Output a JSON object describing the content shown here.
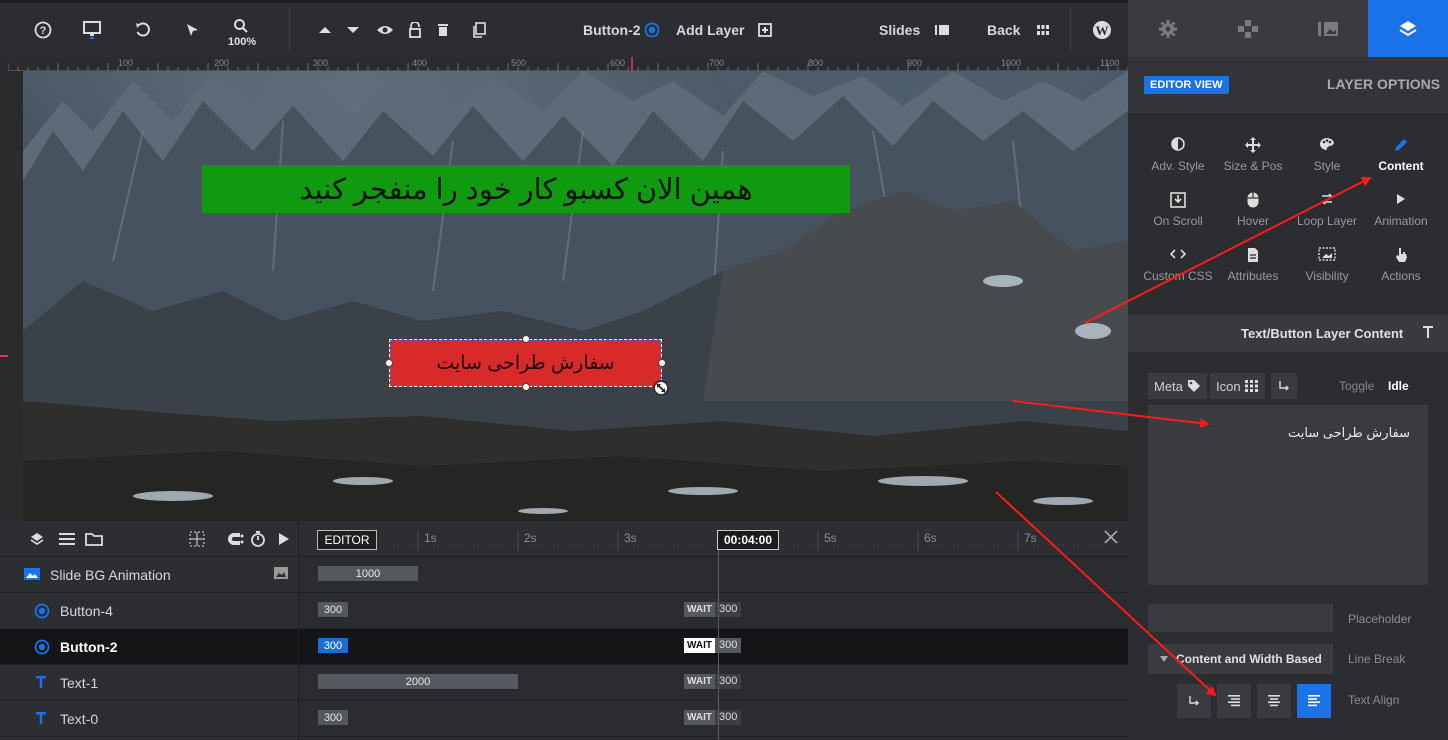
{
  "toolbar": {
    "zoom": "100%",
    "current_layer": "Button-2",
    "add_layer": "Add Layer",
    "slides": "Slides",
    "back": "Back"
  },
  "ruler": {
    "marks": [
      "100",
      "200",
      "300",
      "400",
      "500",
      "600",
      "700",
      "800",
      "900",
      "1000",
      "1100"
    ]
  },
  "canvas": {
    "headline_text": "همین الان کسبو کار خود را منفجر کنید",
    "button_text": "سفارش طراحی سایت",
    "headline_bg": "#0f9a0f",
    "button_bg": "#d92a2a"
  },
  "timeline": {
    "editor_tag": "EDITOR",
    "current_time": "00:04:00",
    "ticks": [
      "1s",
      "2s",
      "3s",
      "5s",
      "6s",
      "7s"
    ],
    "rows": [
      {
        "name": "Slide BG Animation",
        "bar": "1000"
      },
      {
        "name": "Button-4",
        "bar": "300",
        "wait": "WAIT",
        "wait_value": "300"
      },
      {
        "name": "Button-2",
        "bar": "300",
        "wait": "WAIT",
        "wait_value": "300"
      },
      {
        "name": "Text-1",
        "bar": "2000",
        "wait": "WAIT",
        "wait_value": "300"
      },
      {
        "name": "Text-0",
        "bar": "300",
        "wait": "WAIT",
        "wait_value": "300"
      }
    ]
  },
  "panel": {
    "editor_view": "EDITOR VIEW",
    "layer_options": "LAYER OPTIONS",
    "subnav": [
      {
        "label": "Adv. Style",
        "icon": "contrast-icon"
      },
      {
        "label": "Size & Pos",
        "icon": "move-icon"
      },
      {
        "label": "Style",
        "icon": "palette-icon"
      },
      {
        "label": "Content",
        "icon": "pencil-icon"
      },
      {
        "label": "On Scroll",
        "icon": "scroll-icon"
      },
      {
        "label": "Hover",
        "icon": "mouse-icon"
      },
      {
        "label": "Loop Layer",
        "icon": "loop-icon"
      },
      {
        "label": "Animation",
        "icon": "play-icon"
      },
      {
        "label": "Custom CSS",
        "icon": "code-icon"
      },
      {
        "label": "Attributes",
        "icon": "document-icon"
      },
      {
        "label": "Visibility",
        "icon": "visibility-icon"
      },
      {
        "label": "Actions",
        "icon": "pointer-icon"
      }
    ],
    "section_title": "Text/Button Layer Content",
    "meta": "Meta",
    "icon": "Icon",
    "toggle": "Toggle",
    "idle": "Idle",
    "content_text": "سفارش طراحی سایت",
    "placeholder_label": "Placeholder",
    "line_break_value": "Content and Width Based",
    "line_break_label": "Line Break",
    "text_align_label": "Text Align",
    "accent": "#1a73e8"
  }
}
